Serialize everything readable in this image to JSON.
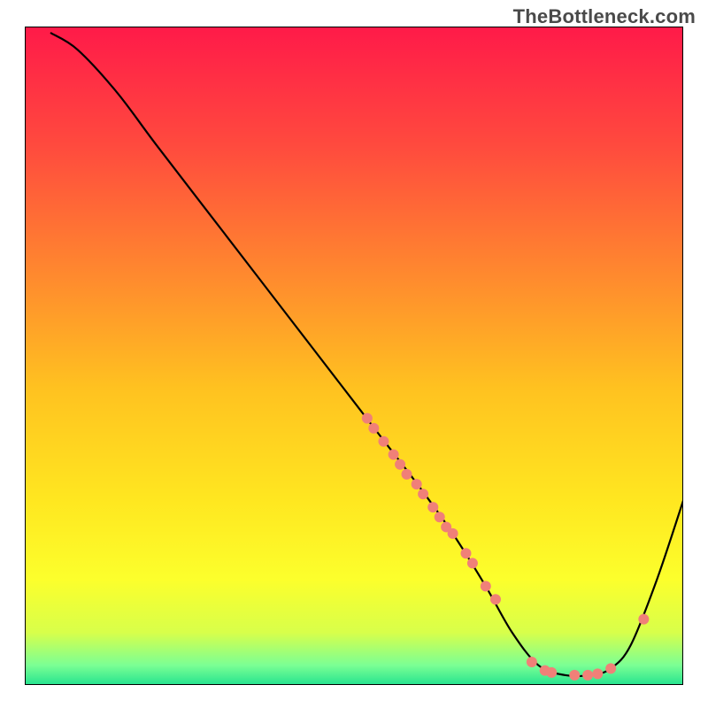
{
  "watermark": "TheBottleneck.com",
  "chart_data": {
    "type": "line",
    "title": "",
    "xlabel": "",
    "ylabel": "",
    "xlim": [
      0,
      100
    ],
    "ylim": [
      0,
      100
    ],
    "grid": false,
    "background_gradient": {
      "type": "vertical",
      "stops": [
        {
          "offset": 0.0,
          "color": "#ff1a49"
        },
        {
          "offset": 0.18,
          "color": "#ff4a3e"
        },
        {
          "offset": 0.38,
          "color": "#ff8a2e"
        },
        {
          "offset": 0.55,
          "color": "#ffc220"
        },
        {
          "offset": 0.72,
          "color": "#ffe720"
        },
        {
          "offset": 0.84,
          "color": "#fcff2c"
        },
        {
          "offset": 0.92,
          "color": "#d8ff4a"
        },
        {
          "offset": 0.97,
          "color": "#7bff94"
        },
        {
          "offset": 1.0,
          "color": "#25e38f"
        }
      ]
    },
    "curve": {
      "description": "Bottleneck-style curve: steep fall from top-left, linear descent, flat valley near x≈80-90, rise on right.",
      "points": [
        {
          "x": 4.0,
          "y": 99.0
        },
        {
          "x": 8.0,
          "y": 96.5
        },
        {
          "x": 14.0,
          "y": 90.0
        },
        {
          "x": 20.0,
          "y": 82.0
        },
        {
          "x": 30.0,
          "y": 69.0
        },
        {
          "x": 40.0,
          "y": 56.0
        },
        {
          "x": 50.0,
          "y": 43.0
        },
        {
          "x": 55.0,
          "y": 36.5
        },
        {
          "x": 60.0,
          "y": 30.0
        },
        {
          "x": 65.0,
          "y": 23.0
        },
        {
          "x": 70.0,
          "y": 15.0
        },
        {
          "x": 74.0,
          "y": 8.0
        },
        {
          "x": 78.0,
          "y": 3.0
        },
        {
          "x": 82.0,
          "y": 1.5
        },
        {
          "x": 86.0,
          "y": 1.5
        },
        {
          "x": 89.0,
          "y": 2.5
        },
        {
          "x": 92.0,
          "y": 6.0
        },
        {
          "x": 96.0,
          "y": 16.0
        },
        {
          "x": 100.0,
          "y": 28.0
        }
      ]
    },
    "markers": {
      "color": "#f08078",
      "radius_px": 6,
      "points": [
        {
          "x": 52.0,
          "y": 40.5
        },
        {
          "x": 53.0,
          "y": 39.0
        },
        {
          "x": 54.5,
          "y": 37.0
        },
        {
          "x": 56.0,
          "y": 35.0
        },
        {
          "x": 57.0,
          "y": 33.5
        },
        {
          "x": 58.0,
          "y": 32.0
        },
        {
          "x": 59.5,
          "y": 30.5
        },
        {
          "x": 60.5,
          "y": 29.0
        },
        {
          "x": 62.0,
          "y": 27.0
        },
        {
          "x": 63.0,
          "y": 25.5
        },
        {
          "x": 64.0,
          "y": 24.0
        },
        {
          "x": 65.0,
          "y": 23.0
        },
        {
          "x": 67.0,
          "y": 20.0
        },
        {
          "x": 68.0,
          "y": 18.5
        },
        {
          "x": 70.0,
          "y": 15.0
        },
        {
          "x": 71.5,
          "y": 13.0
        },
        {
          "x": 77.0,
          "y": 3.5
        },
        {
          "x": 79.0,
          "y": 2.2
        },
        {
          "x": 80.0,
          "y": 1.9
        },
        {
          "x": 83.5,
          "y": 1.5
        },
        {
          "x": 85.5,
          "y": 1.5
        },
        {
          "x": 87.0,
          "y": 1.7
        },
        {
          "x": 89.0,
          "y": 2.5
        },
        {
          "x": 94.0,
          "y": 10.0
        }
      ]
    }
  }
}
